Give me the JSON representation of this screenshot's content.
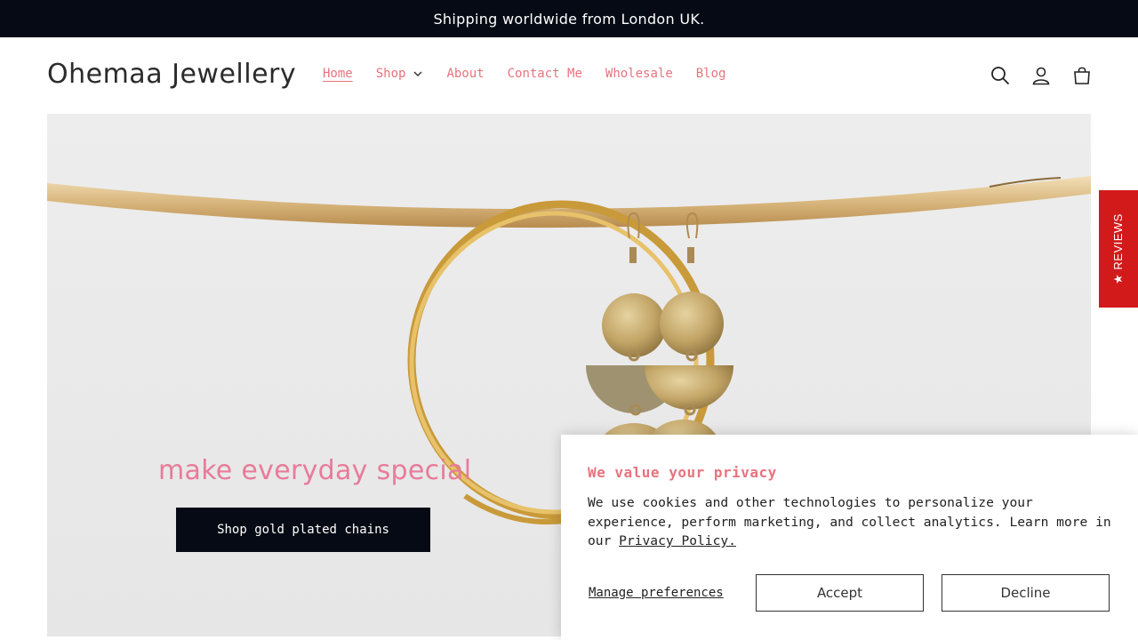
{
  "announcement": "Shipping worldwide from London UK.",
  "header": {
    "logo": "Ohemaa Jewellery",
    "nav": [
      {
        "label": "Home",
        "active": true
      },
      {
        "label": "Shop",
        "has_dropdown": true
      },
      {
        "label": "About"
      },
      {
        "label": "Contact Me"
      },
      {
        "label": "Wholesale"
      },
      {
        "label": "Blog"
      }
    ],
    "icons": [
      "search-icon",
      "account-icon",
      "cart-icon"
    ]
  },
  "hero": {
    "heading": "make everyday special",
    "button": "Shop gold plated chains"
  },
  "reviews_tab": "★ REVIEWS",
  "privacy": {
    "title": "We value your privacy",
    "body": "We use cookies and other technologies to personalize your experience, perform marketing, and collect analytics. Learn more in our ",
    "link": "Privacy Policy.",
    "manage": "Manage preferences",
    "accept": "Accept",
    "decline": "Decline"
  },
  "colors": {
    "announcement_bg": "#050a14",
    "nav_link": "#e8737e",
    "hero_heading": "#e87b9a",
    "reviews_tab": "#d31a1a"
  }
}
